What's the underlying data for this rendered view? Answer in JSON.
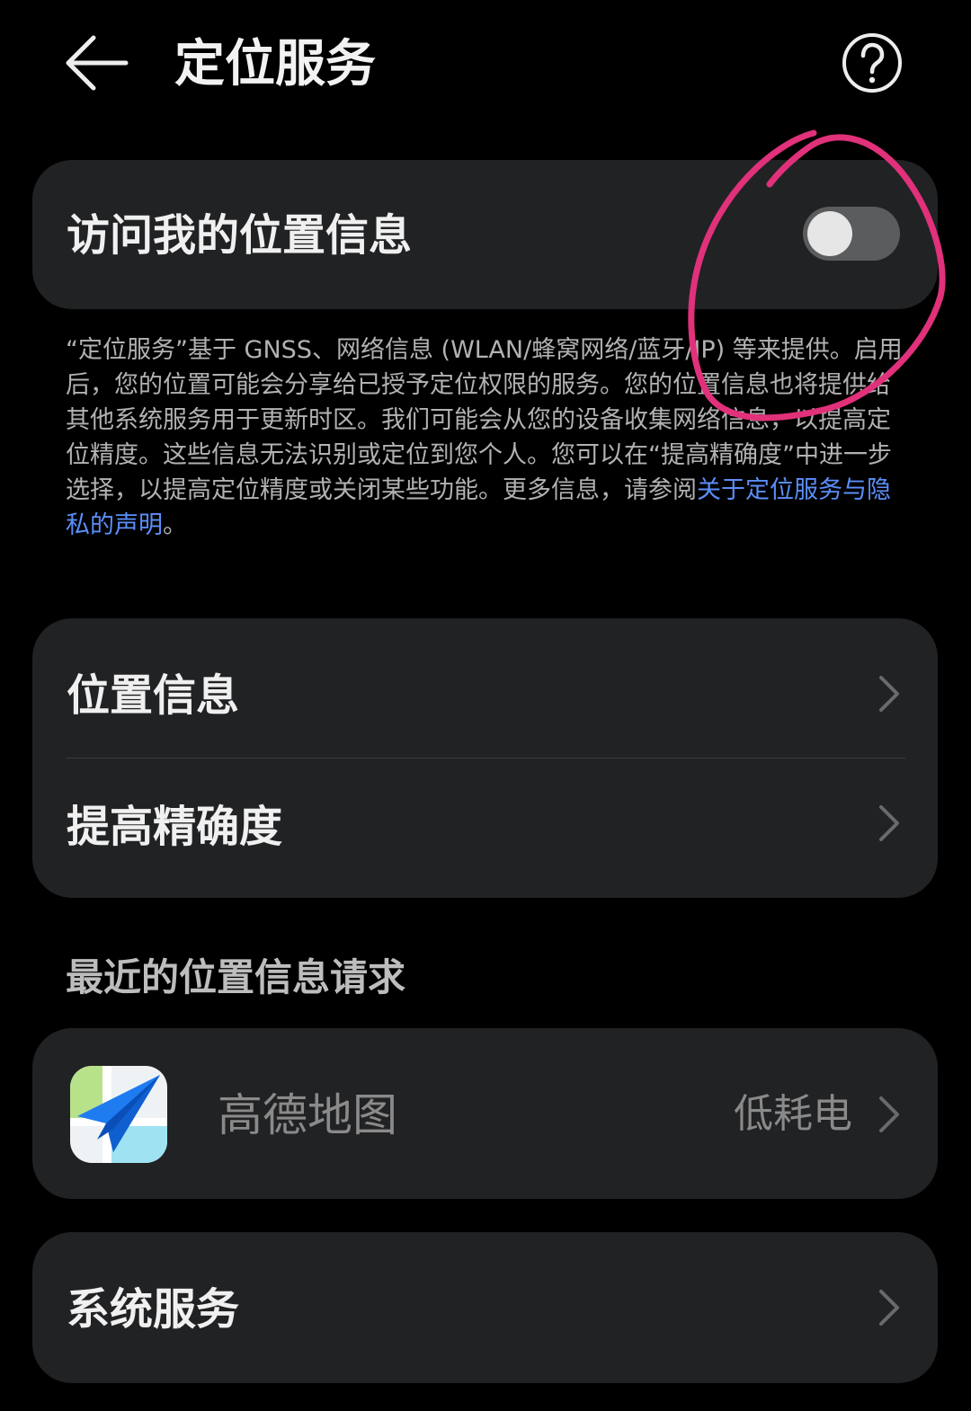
{
  "header": {
    "title": "定位服务"
  },
  "location_access": {
    "label": "访问我的位置信息",
    "enabled": false
  },
  "description": {
    "text": "“定位服务”基于 GNSS、网络信息 (WLAN/蜂窝网络/蓝牙/IP) 等来提供。启用后，您的位置可能会分享给已授予定位权限的服务。您的位置信息也将提供给其他系统服务用于更新时区。我们可能会从您的设备收集网络信息，以提高定位精度。这些信息无法识别或定位到您个人。您可以在“提高精确度”中进一步选择，以提高定位精度或关闭某些功能。更多信息，请参阅",
    "link_text": "关于定位服务与隐私的声明",
    "suffix": "。"
  },
  "nav_items": [
    {
      "label": "位置信息"
    },
    {
      "label": "提高精确度"
    }
  ],
  "recent_requests": {
    "header": "最近的位置信息请求",
    "apps": [
      {
        "name": "高德地图",
        "mode": "低耗电",
        "icon": "amap-app-icon"
      }
    ]
  },
  "system_services": {
    "label": "系统服务"
  },
  "colors": {
    "background": "#000000",
    "card": "#212224",
    "link": "#5b8ff9",
    "annotation": "#e0317a"
  }
}
